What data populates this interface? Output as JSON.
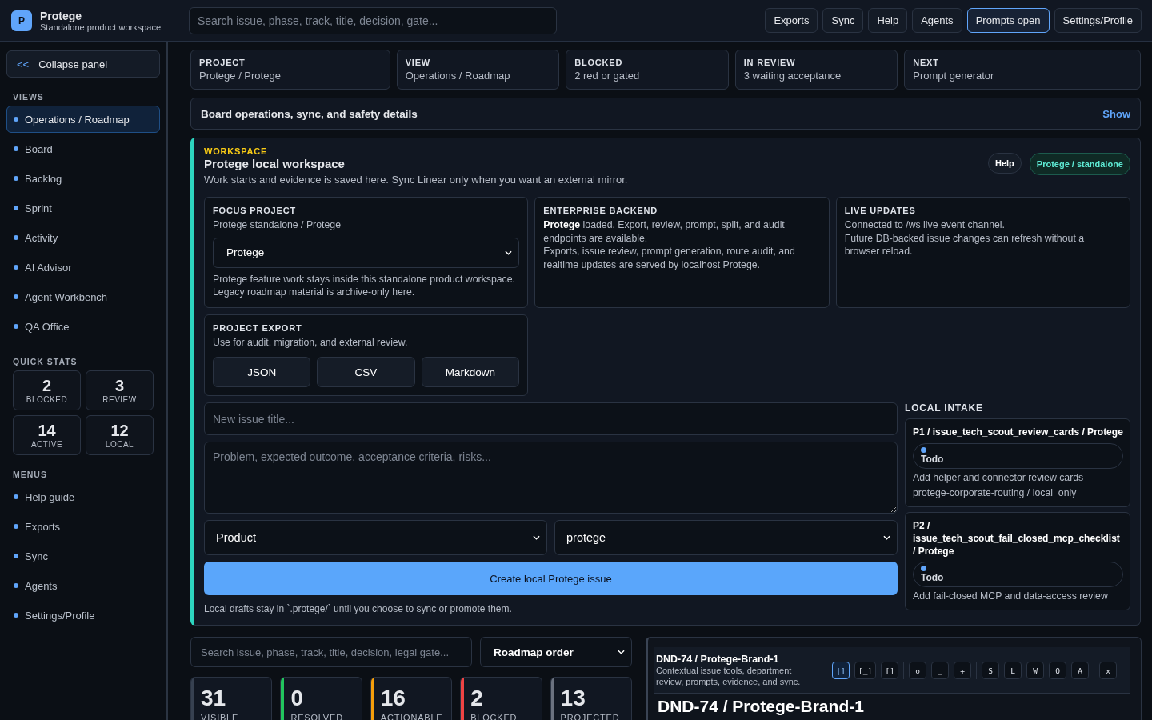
{
  "app": {
    "logo": "P",
    "title": "Protege",
    "subtitle": "Standalone product workspace"
  },
  "search": {
    "placeholder": "Search issue, phase, track, title, decision, gate..."
  },
  "top_buttons": [
    {
      "label": "Exports",
      "selected": false
    },
    {
      "label": "Sync",
      "selected": false
    },
    {
      "label": "Help",
      "selected": false
    },
    {
      "label": "Agents",
      "selected": false
    },
    {
      "label": "Prompts open",
      "selected": true
    },
    {
      "label": "Settings/Profile",
      "selected": false
    }
  ],
  "sidebar": {
    "collapse": {
      "icon": "<<",
      "label": "Collapse panel"
    },
    "views_heading": "VIEWS",
    "views": [
      {
        "label": "Operations / Roadmap",
        "selected": true
      },
      {
        "label": "Board",
        "selected": false
      },
      {
        "label": "Backlog",
        "selected": false
      },
      {
        "label": "Sprint",
        "selected": false
      },
      {
        "label": "Activity",
        "selected": false
      },
      {
        "label": "AI Advisor",
        "selected": false
      },
      {
        "label": "Agent Workbench",
        "selected": false
      },
      {
        "label": "QA Office",
        "selected": false
      }
    ],
    "stats_heading": "QUICK STATS",
    "stats": [
      {
        "value": "2",
        "label": "BLOCKED"
      },
      {
        "value": "3",
        "label": "REVIEW"
      },
      {
        "value": "14",
        "label": "ACTIVE"
      },
      {
        "value": "12",
        "label": "LOCAL"
      }
    ],
    "menus_heading": "MENUS",
    "menus": [
      "Help guide",
      "Exports",
      "Sync",
      "Agents",
      "Settings/Profile"
    ]
  },
  "summary": [
    {
      "label": "PROJECT",
      "value": "Protege / Protege"
    },
    {
      "label": "VIEW",
      "value": "Operations / Roadmap"
    },
    {
      "label": "BLOCKED",
      "value": "2 red or gated"
    },
    {
      "label": "IN REVIEW",
      "value": "3 waiting acceptance"
    },
    {
      "label": "NEXT",
      "value": "Prompt generator"
    }
  ],
  "details_bar": {
    "title": "Board operations, sync, and safety details",
    "action": "Show"
  },
  "workspace": {
    "eyebrow": "WORKSPACE",
    "title": "Protege local workspace",
    "description": "Work starts and evidence is saved here. Sync Linear only when you want an external mirror.",
    "help": "Help",
    "badge": "Protege / standalone",
    "focus": {
      "heading": "FOCUS PROJECT",
      "subtitle": "Protege standalone / Protege",
      "select": "Protege",
      "note": "Protege feature work stays inside this standalone product workspace. Legacy roadmap material is archive-only here."
    },
    "backend": {
      "heading": "ENTERPRISE BACKEND",
      "lines": [
        "**Protege** loaded. Export, review, prompt, split, and audit endpoints are available.",
        "Exports, issue review, prompt generation, route audit, and realtime updates are served by localhost Protege."
      ]
    },
    "live": {
      "heading": "LIVE UPDATES",
      "lines": [
        "Connected to /ws live event channel.",
        "Future DB-backed issue changes can refresh without a browser reload."
      ]
    },
    "export": {
      "heading": "PROJECT EXPORT",
      "subtitle": "Use for audit, migration, and external review.",
      "buttons": [
        "JSON",
        "CSV",
        "Markdown"
      ]
    },
    "form": {
      "title_placeholder": "New issue title...",
      "body_placeholder": "Problem, expected outcome, acceptance criteria, risks...",
      "department": "Product",
      "project": "protege",
      "submit": "Create local Protege issue",
      "note": "Local drafts stay in `.protege/` until you choose to sync or promote them."
    },
    "intake": {
      "heading": "LOCAL INTAKE",
      "items": [
        {
          "title": "P1 / issue_tech_scout_review_cards / Protege",
          "status": "Todo",
          "color": "#60a5fa",
          "summary": "Add helper and connector review cards",
          "route": "protege-corporate-routing / local_only"
        },
        {
          "title": "P2 / issue_tech_scout_fail_closed_mcp_checklist / Protege",
          "status": "Todo",
          "color": "#60a5fa",
          "summary": "Add fail-closed MCP and data-access review"
        }
      ]
    }
  },
  "board": {
    "search_placeholder": "Search issue, phase, track, title, decision, legal gate...",
    "order": "Roadmap order",
    "stats": [
      {
        "value": "31",
        "label": "VISIBLE",
        "color": "#374151"
      },
      {
        "value": "0",
        "label": "RESOLVED",
        "color": "#22c55e"
      },
      {
        "value": "16",
        "label": "ACTIONABLE",
        "color": "#f59e0b"
      },
      {
        "value": "2",
        "label": "BLOCKED",
        "color": "#ef4444"
      },
      {
        "value": "13",
        "label": "PROJECTED",
        "color": "#6b7280"
      }
    ]
  },
  "issue_panel": {
    "key": "DND-74 / Protege-Brand-1",
    "description": "Contextual issue tools, department review, prompts, evidence, and sync.",
    "tools": [
      [
        {
          "label": "|]",
          "selected": true
        },
        {
          "label": "[_]",
          "selected": false
        },
        {
          "label": "[]",
          "selected": false
        }
      ],
      [
        {
          "label": "o",
          "selected": false
        },
        {
          "label": "_",
          "selected": false
        },
        {
          "label": "+",
          "selected": false
        }
      ],
      [
        {
          "label": "S",
          "selected": false
        },
        {
          "label": "L",
          "selected": false
        },
        {
          "label": "W",
          "selected": false
        },
        {
          "label": "Q",
          "selected": false
        },
        {
          "label": "A",
          "selected": false
        }
      ],
      [
        {
          "label": "x",
          "selected": false
        }
      ]
    ],
    "title": "DND-74 / Protege-Brand-1"
  }
}
